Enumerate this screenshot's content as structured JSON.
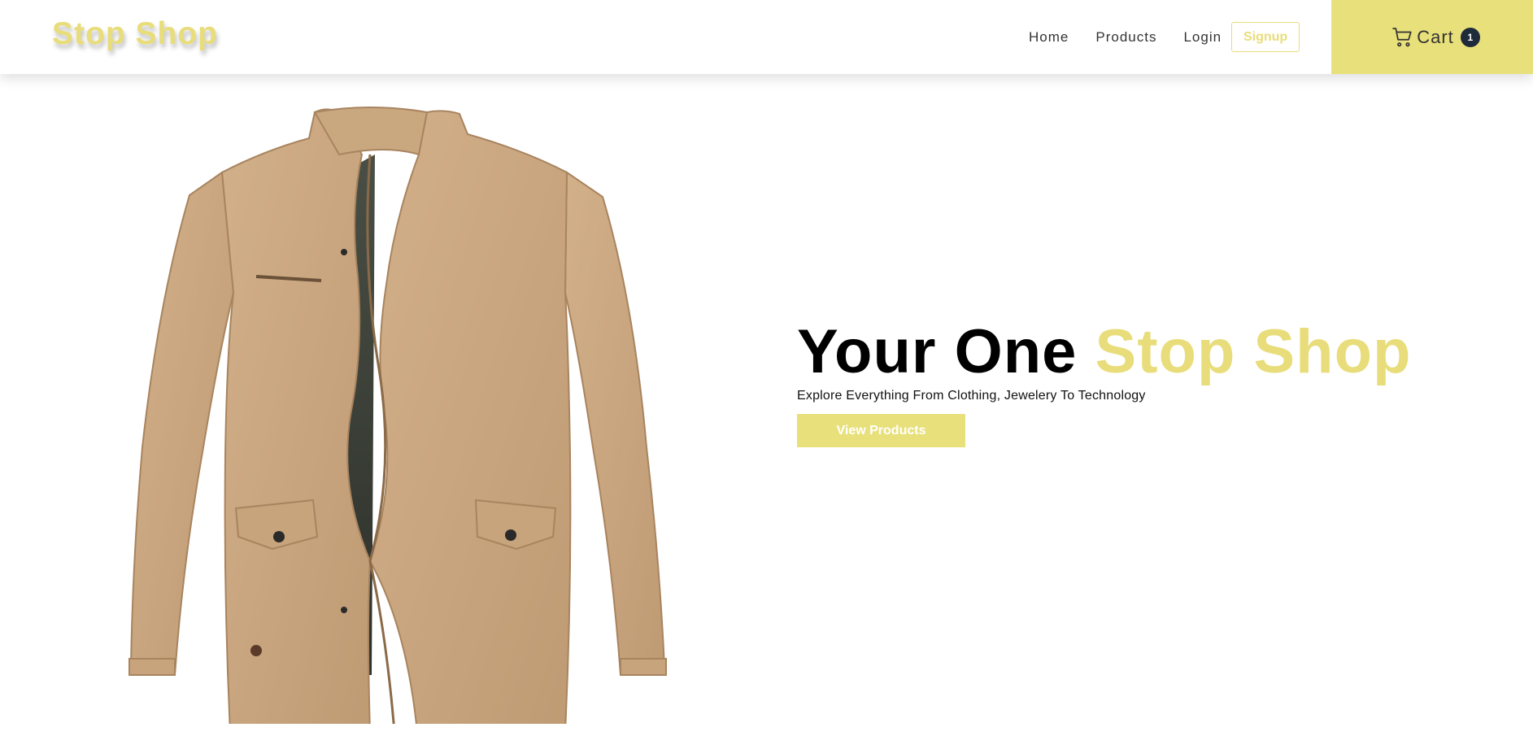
{
  "brand": {
    "name": "Stop Shop",
    "accent_color": "#e8dd7a",
    "cart_bg": "#e8e07a"
  },
  "nav": {
    "links": [
      {
        "label": "Home"
      },
      {
        "label": "Products"
      },
      {
        "label": "Login"
      }
    ],
    "signup_label": "Signup"
  },
  "cart": {
    "icon": "cart-icon",
    "label": "Cart",
    "count": "1"
  },
  "hero": {
    "headline_dark": "Your One",
    "headline_accent": "Stop Shop",
    "subline": "Explore Everything From Clothing, Jewelery To Technology",
    "cta_label": "View Products",
    "image": "khaki-jacket-image"
  }
}
